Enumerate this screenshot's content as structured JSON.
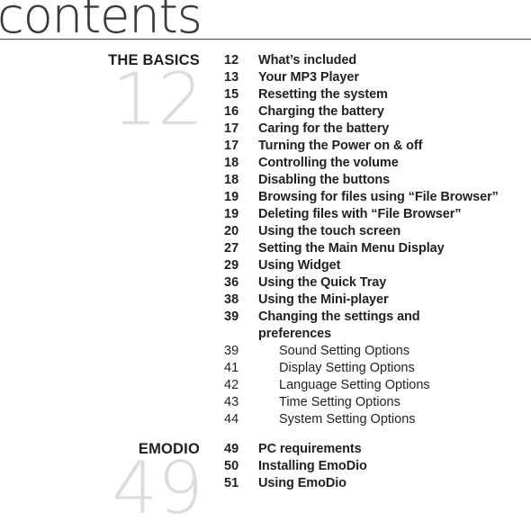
{
  "page": {
    "title": "contents"
  },
  "sections": [
    {
      "label": "THE BASICS",
      "number": "12",
      "entries": [
        {
          "page": "12",
          "title": "What’s included",
          "level": "main"
        },
        {
          "page": "13",
          "title": "Your MP3 Player",
          "level": "main"
        },
        {
          "page": "15",
          "title": "Resetting the system",
          "level": "main"
        },
        {
          "page": "16",
          "title": "Charging the battery",
          "level": "main"
        },
        {
          "page": "17",
          "title": "Caring for the battery",
          "level": "main"
        },
        {
          "page": "17",
          "title": "Turning the Power on & off",
          "level": "main"
        },
        {
          "page": "18",
          "title": "Controlling the volume",
          "level": "main"
        },
        {
          "page": "18",
          "title": "Disabling the buttons",
          "level": "main"
        },
        {
          "page": "19",
          "title": "Browsing for files using “File Browser”",
          "level": "main"
        },
        {
          "page": "19",
          "title": "Deleting files with “File Browser”",
          "level": "main"
        },
        {
          "page": "20",
          "title": "Using the touch screen",
          "level": "main"
        },
        {
          "page": "27",
          "title": "Setting the Main Menu Display",
          "level": "main"
        },
        {
          "page": "29",
          "title": "Using Widget",
          "level": "main"
        },
        {
          "page": "36",
          "title": "Using the Quick Tray",
          "level": "main"
        },
        {
          "page": "38",
          "title": "Using the Mini-player",
          "level": "main"
        },
        {
          "page": "39",
          "title": "Changing the settings and\npreferences",
          "level": "main"
        },
        {
          "page": "39",
          "title": "Sound Setting Options",
          "level": "sub"
        },
        {
          "page": "41",
          "title": "Display Setting Options",
          "level": "sub"
        },
        {
          "page": "42",
          "title": "Language Setting Options",
          "level": "sub"
        },
        {
          "page": "43",
          "title": "Time Setting Options",
          "level": "sub"
        },
        {
          "page": "44",
          "title": "System Setting Options",
          "level": "sub"
        }
      ]
    },
    {
      "label": "EMODIO",
      "number": "49",
      "entries": [
        {
          "page": "49",
          "title": "PC requirements",
          "level": "main"
        },
        {
          "page": "50",
          "title": "Installing EmoDio",
          "level": "main"
        },
        {
          "page": "51",
          "title": "Using EmoDio",
          "level": "main"
        }
      ]
    }
  ]
}
